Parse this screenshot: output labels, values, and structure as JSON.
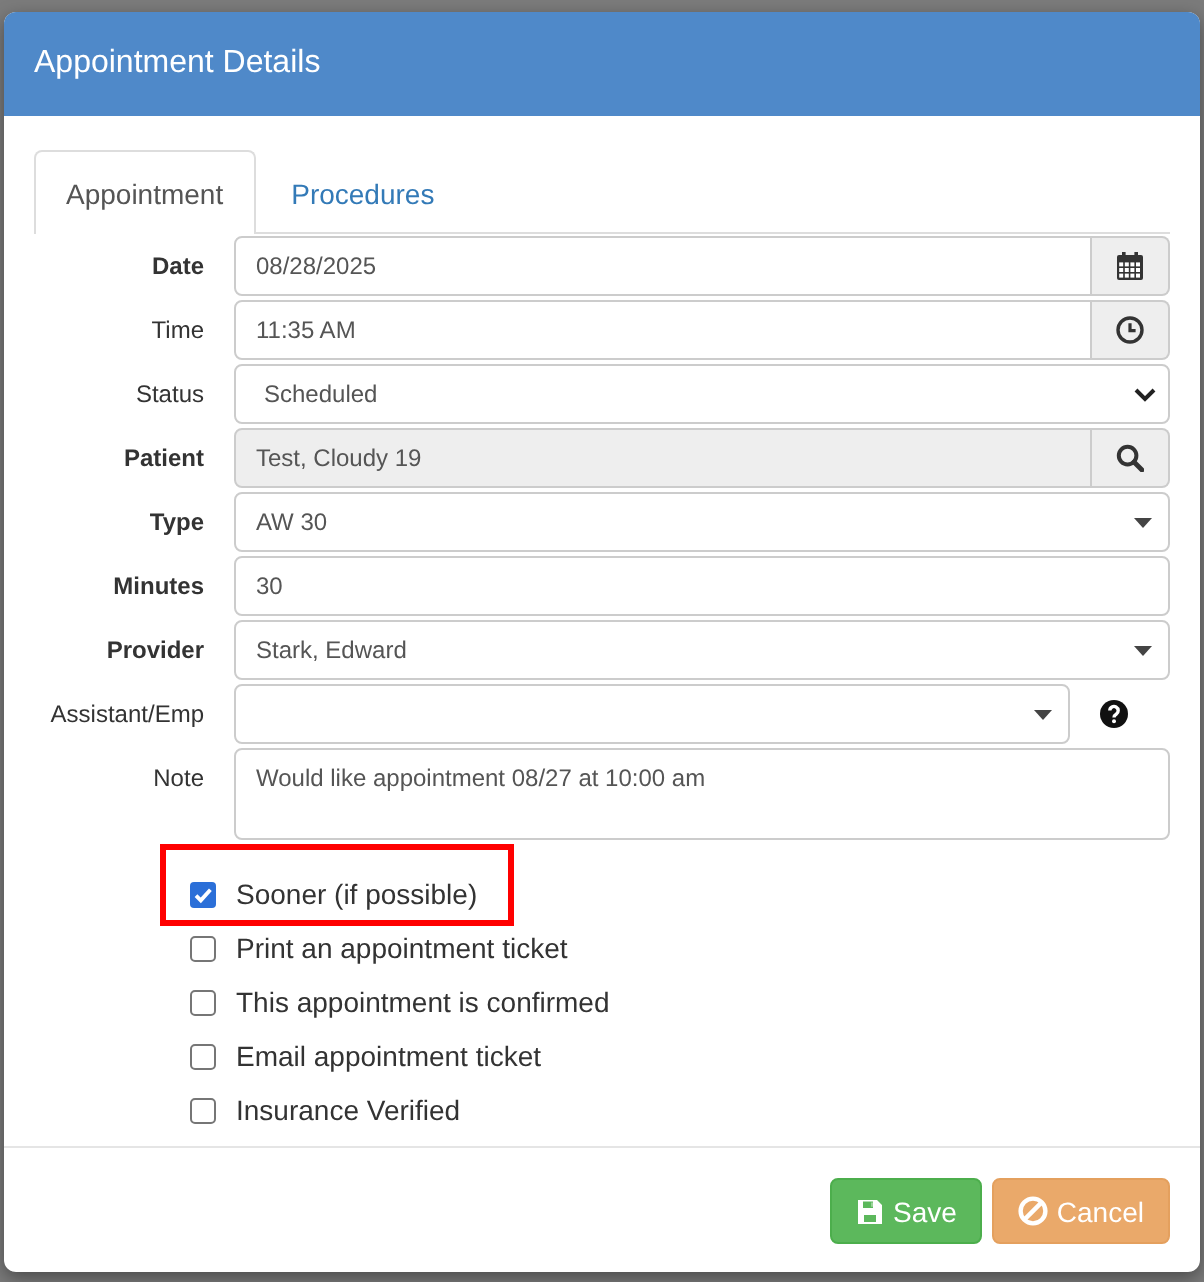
{
  "dialog": {
    "title": "Appointment Details"
  },
  "tabs": [
    {
      "label": "Appointment",
      "selected": true
    },
    {
      "label": "Procedures",
      "selected": false
    }
  ],
  "fields": [
    {
      "kind": "date",
      "label": "Date",
      "required": true,
      "disabled": false,
      "help": false,
      "value": "08/28/2025"
    },
    {
      "kind": "time",
      "label": "Time",
      "required": false,
      "disabled": false,
      "help": false,
      "value": "11:35 AM"
    },
    {
      "kind": "select",
      "label": "Status",
      "required": false,
      "disabled": false,
      "help": false,
      "value": "Scheduled"
    },
    {
      "kind": "lookup",
      "label": "Patient",
      "required": true,
      "disabled": true,
      "help": false,
      "value": "Test, Cloudy 19"
    },
    {
      "kind": "combo",
      "label": "Type",
      "required": true,
      "disabled": false,
      "help": false,
      "value": "AW 30"
    },
    {
      "kind": "text",
      "label": "Minutes",
      "required": true,
      "disabled": false,
      "help": false,
      "value": "30"
    },
    {
      "kind": "combo",
      "label": "Provider",
      "required": true,
      "disabled": false,
      "help": false,
      "value": "Stark, Edward"
    },
    {
      "kind": "combo",
      "label": "Assistant/Emp",
      "required": false,
      "disabled": false,
      "help": true
    },
    {
      "kind": "textarea",
      "label": "Note",
      "required": false,
      "disabled": false,
      "help": false,
      "value": "Would like appointment 08/27 at 10:00 am"
    }
  ],
  "options": [
    {
      "label": "Sooner (if possible)",
      "checked": true,
      "highlighted": true
    },
    {
      "label": "Print an appointment ticket",
      "checked": false,
      "highlighted": false
    },
    {
      "label": "This appointment is confirmed",
      "checked": false,
      "highlighted": false
    },
    {
      "label": "Email appointment ticket",
      "checked": false,
      "highlighted": false
    },
    {
      "label": "Insurance Verified",
      "checked": false,
      "highlighted": false
    }
  ],
  "buttons": [
    {
      "kind": "save",
      "label": "Save"
    },
    {
      "kind": "cancel",
      "label": "Cancel"
    }
  ]
}
